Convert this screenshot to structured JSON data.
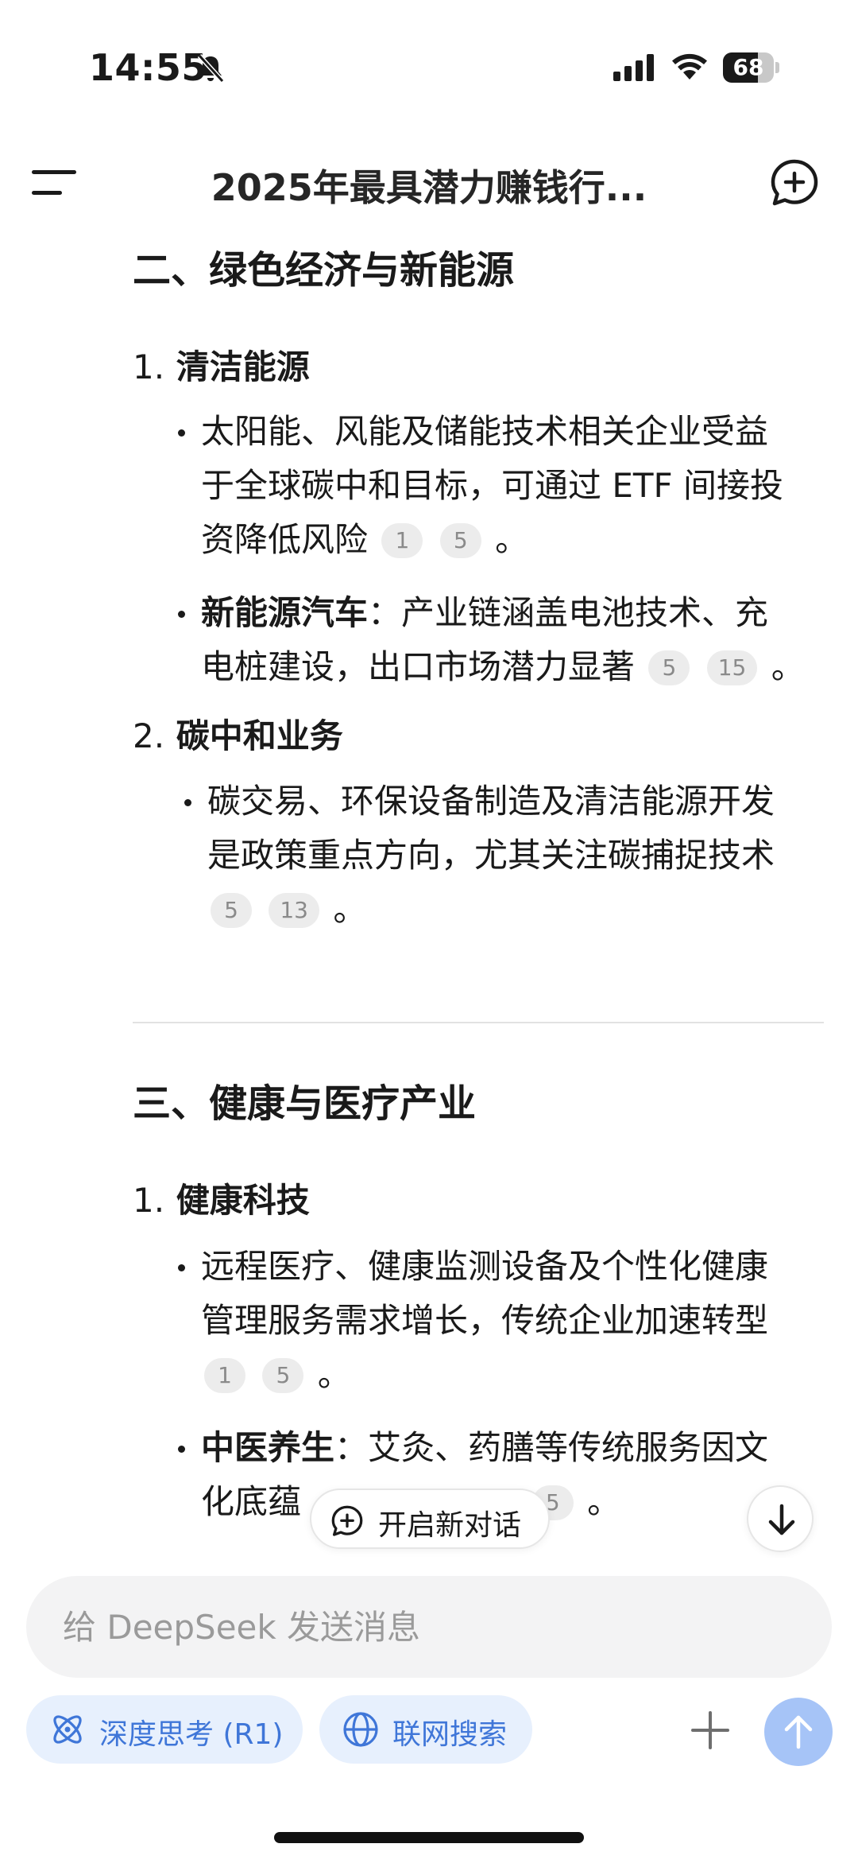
{
  "status_bar": {
    "time": "14:55",
    "battery": "68",
    "battery_level": 0.68,
    "icons": [
      "bell-slash-icon",
      "signal-icon",
      "wifi-icon",
      "battery-icon"
    ]
  },
  "header": {
    "title": "2025年最具潜力赚钱行...",
    "menu_icon": "hamburger-menu-icon",
    "new_chat_icon": "new-chat-icon"
  },
  "content": {
    "section2": {
      "title": "二、绿色经济与新能源",
      "item1": {
        "number": "1.",
        "title": "清洁能源",
        "bullet1": {
          "line1": "太阳能、风能及储能技术相关企业受益",
          "line2": "于全球碳中和目标，可通过 ETF 间接投",
          "line3_text": "资降低风险",
          "cites": [
            "1",
            "5"
          ],
          "end": "。"
        },
        "bullet2": {
          "bold": "新能源汽车",
          "line1_rest": "：产业链涵盖电池技术、充",
          "line2_text": "电桩建设，出口市场潜力显著",
          "cites": [
            "5",
            "15"
          ],
          "end": "。"
        }
      },
      "item2": {
        "number": "2.",
        "title": "碳中和业务",
        "bullet1": {
          "line1": "碳交易、环保设备制造及清洁能源开发",
          "line2": "是政策重点方向，尤其关注碳捕捉技术",
          "cites": [
            "5",
            "13"
          ],
          "end": "。"
        }
      }
    },
    "section3": {
      "title": "三、健康与医疗产业",
      "item1": {
        "number": "1.",
        "title": "健康科技",
        "bullet1": {
          "line1": "远程医疗、健康监测设备及个性化健康",
          "line2": "管理服务需求增长，传统企业加速转型",
          "cites": [
            "1",
            "5"
          ],
          "end": "。"
        },
        "bullet2": {
          "bold": "中医养生",
          "line1_rest": "：艾灸、药膳等传统服务因文",
          "line2_text": "化底蕴",
          "cites": [
            "5"
          ],
          "end": "。"
        }
      }
    }
  },
  "floating": {
    "open_chat_label": "开启新对话",
    "scroll_down_icon": "arrow-down-icon"
  },
  "composer": {
    "placeholder": "给 DeepSeek 发送消息",
    "deep_think_label": "深度思考 (R1)",
    "web_search_label": "联网搜索",
    "accent_color": "#3f76d8",
    "chip_bg": "#e7f0fd",
    "send_color": "#a6c4f7"
  }
}
